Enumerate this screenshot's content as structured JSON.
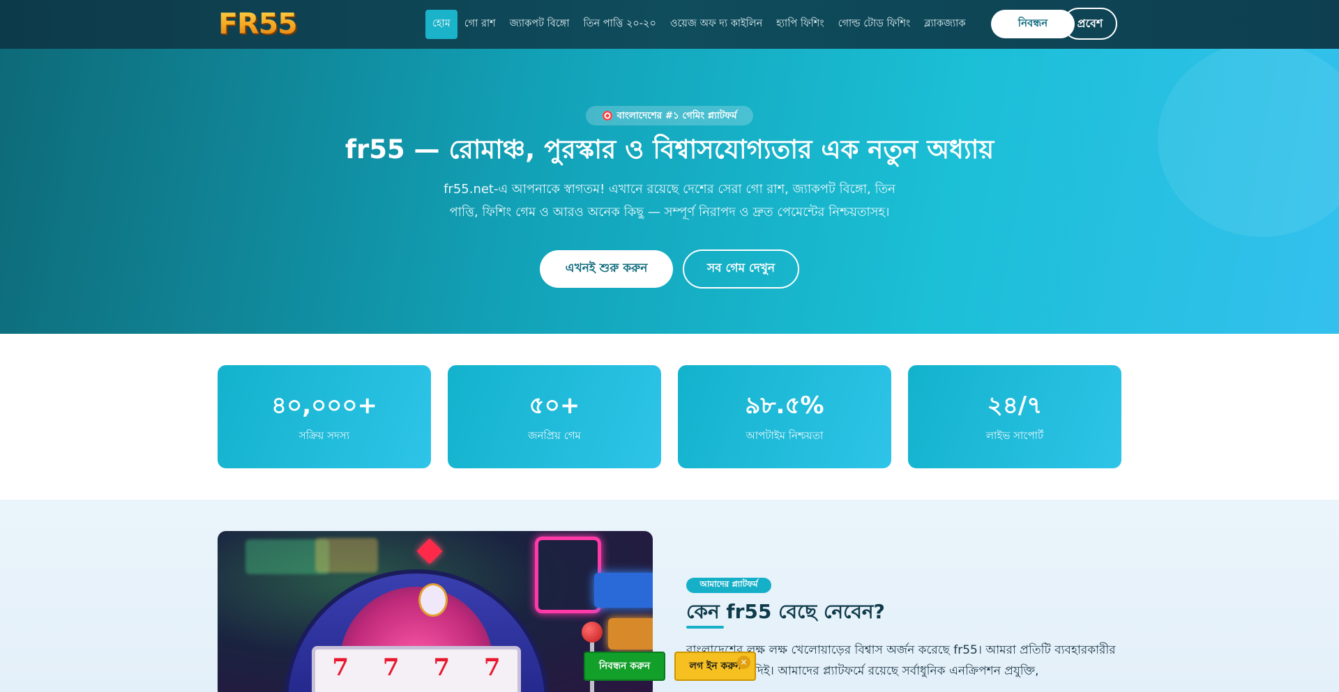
{
  "brand": {
    "logo_text": "FR55"
  },
  "nav": {
    "items": [
      {
        "label": "হোম",
        "active": true
      },
      {
        "label": "গো রাশ",
        "active": false
      },
      {
        "label": "জ্যাকপট বিঙ্গো",
        "active": false
      },
      {
        "label": "তিন পাত্তি ২০-২০",
        "active": false
      },
      {
        "label": "ওয়েজ অফ দ্য কাইলিন",
        "active": false
      },
      {
        "label": "হ্যাপি ফিশিং",
        "active": false
      },
      {
        "label": "গোল্ড টোড ফিশিং",
        "active": false
      },
      {
        "label": "ব্ল্যাকজ্যাক",
        "active": false
      }
    ],
    "register_label": "নিবন্ধন",
    "login_label": "প্রবেশ"
  },
  "hero": {
    "badge": "বাংলাদেশের #১ গেমিং প্ল্যাটফর্ম",
    "badge_icon": "target-icon",
    "title": "fr55 — রোমাঞ্চ, পুরস্কার ও বিশ্বাসযোগ্যতার এক নতুন অধ্যায়",
    "description": "fr55.net-এ আপনাকে স্বাগতম! এখানে রয়েছে দেশের সেরা গো রাশ, জ্যাকপট বিঙ্গো, তিন পাত্তি, ফিশিং গেম ও আরও অনেক কিছু — সম্পূর্ণ নিরাপদ ও দ্রুত পেমেন্টের নিশ্চয়তাসহ।",
    "start_button": "এখনই শুরু করুন",
    "games_button": "সব গেম দেখুন"
  },
  "stats": [
    {
      "value": "৪০,০০০+",
      "label": "সক্রিয় সদস্য"
    },
    {
      "value": "৫০+",
      "label": "জনপ্রিয় গেম"
    },
    {
      "value": "৯৮.৫%",
      "label": "আপটাইম নিশ্চয়তা"
    },
    {
      "value": "২৪/৭",
      "label": "লাইভ সাপোর্ট"
    }
  ],
  "platform": {
    "badge": "আমাদের প্ল্যাটফর্ম",
    "title": "কেন fr55 বেছে নেবেন?",
    "body_visible": "বাংলাদেশের লক্ষ লক্ষ খেলোয়াড়ের বিশ্বাস অর্জন করেছে fr55। আমরা প্রতিটি ব্যবহারকারীর সর্বোচ্চ গুরুত্ব দিই। আমাদের প্ল্যাটফর্মে রয়েছে সর্বাধুনিক এনক্রিপশন প্রযুক্তি,"
  },
  "floating": {
    "register_label": "নিবন্ধন করুন",
    "login_label": "লগ ইন করুন",
    "close_symbol": "×"
  },
  "colors": {
    "nav_bg": "#0d3a4a",
    "accent": "#15b0c8",
    "logo_gold": "#f5a623",
    "float_green": "#12a02a",
    "float_yellow": "#f5c020"
  }
}
